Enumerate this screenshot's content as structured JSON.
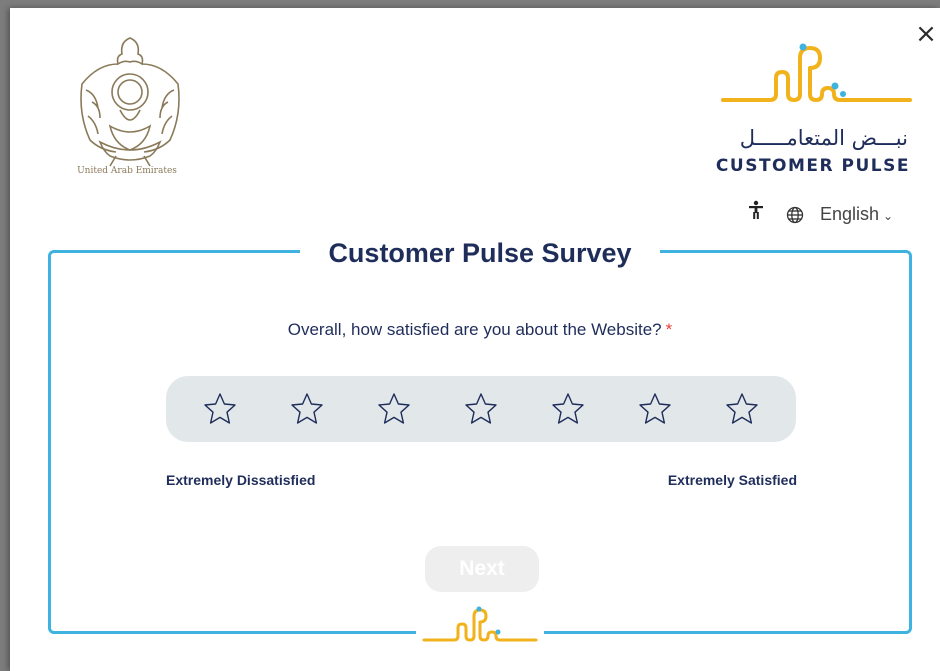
{
  "header": {
    "close_glyph": "×",
    "uae_caption": "United Arab Emirates",
    "brand_arabic": "نبـــض المتعامـــــل",
    "brand_english": "CUSTOMER PULSE",
    "language": "English"
  },
  "survey": {
    "title": "Customer Pulse Survey",
    "question": "Overall, how satisfied are you about the Website?",
    "required_mark": "*",
    "rating": {
      "max_stars": 7,
      "selected": 0
    },
    "label_low": "Extremely Dissatisfied",
    "label_high": "Extremely Satisfied",
    "next_label": "Next"
  },
  "colors": {
    "accent_blue": "#3fb3e0",
    "brand_gold": "#f2b21b",
    "navy": "#1f2d5a",
    "required_red": "#e2403a",
    "rating_bg": "#e2e7ea"
  },
  "icons": [
    "close-icon",
    "uae-emblem",
    "customer-pulse-logo",
    "accessibility-icon",
    "globe-icon",
    "chevron-down-icon",
    "star-icon"
  ]
}
